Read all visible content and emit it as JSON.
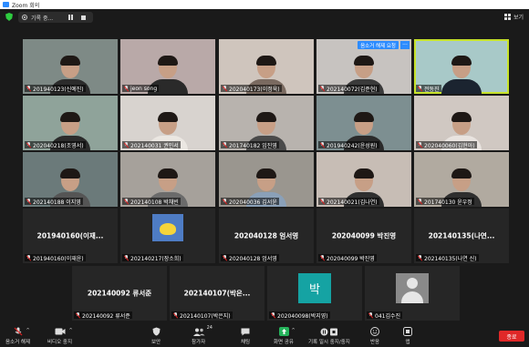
{
  "window": {
    "title": "Zoom 회의"
  },
  "topbar": {
    "recording_label": "기록 중...",
    "view_label": "보기"
  },
  "tiles": [
    {
      "name": "201940123(신예진)",
      "kind": "video",
      "bg": "#7e8a86",
      "shirt": "#2b2b2b"
    },
    {
      "name": "jeon song",
      "kind": "video",
      "bg": "#b9a9a8",
      "shirt": "#2a2a2a"
    },
    {
      "name": "202040173(이정욱)",
      "kind": "video",
      "bg": "#cfc5bd",
      "shirt": "#7a6a60"
    },
    {
      "name": "202140072(김준현)",
      "kind": "video",
      "bg": "#c7c3c0",
      "shirt": "#3a3a3a",
      "badge": "음소거 해제 요청",
      "more": "···"
    },
    {
      "name": "전동진",
      "kind": "video",
      "bg": "#a8c9c8",
      "shirt": "#1b2430",
      "active": true
    },
    {
      "name": "202040218(조영서)",
      "kind": "video",
      "bg": "#8fa39a",
      "shirt": "#2b2b2b"
    },
    {
      "name": "202140031 권민서",
      "kind": "video",
      "bg": "#d8d3cf",
      "shirt": "#ebe7e2"
    },
    {
      "name": "201740182 임진영",
      "kind": "video",
      "bg": "#b8b3ae",
      "shirt": "#4a4a4a"
    },
    {
      "name": "201940242(윤성원)",
      "kind": "video",
      "bg": "#7d8f91",
      "shirt": "#2a2a2a"
    },
    {
      "name": "202040060(김현아)",
      "kind": "video",
      "bg": "#d0c8c2",
      "shirt": "#e9e4e0"
    },
    {
      "name": "202140188 이지영",
      "kind": "video",
      "bg": "#6b7a7a",
      "shirt": "#555"
    },
    {
      "name": "202140108 박채빈",
      "kind": "video",
      "bg": "#a6a19b",
      "shirt": "#6b6b6b"
    },
    {
      "name": "202040036 김서윤",
      "kind": "video",
      "bg": "#9a968f",
      "shirt": "#8aa0b8"
    },
    {
      "name": "202140021(김나연)",
      "kind": "video",
      "bg": "#c7bdb5",
      "shirt": "#2f2f2f"
    },
    {
      "name": "201740130 윤우정",
      "kind": "video",
      "bg": "#b1aaa0",
      "shirt": "#2e2e2e"
    },
    {
      "name": "201940160(이재윤)",
      "kind": "text",
      "big": "201940160(이재..."
    },
    {
      "name": "202140217(장소희)",
      "kind": "avatar-blue"
    },
    {
      "name": "202040128 엄서영",
      "kind": "text",
      "big": "202040128 엄서영"
    },
    {
      "name": "202040099 박진영",
      "kind": "text",
      "big": "202040099 박진영"
    },
    {
      "name": "202140135(나연 신)",
      "kind": "text",
      "big": "202140135(나연..."
    },
    {
      "name": "202140092 류서준",
      "kind": "text",
      "big": "202140092 류서준"
    },
    {
      "name": "202140107(박은지)",
      "kind": "text",
      "big": "202140107(박은..."
    },
    {
      "name": "202040098(박지영)",
      "kind": "avatar-teal",
      "initial": "박"
    },
    {
      "name": "041김수진",
      "kind": "avatar-gray"
    }
  ],
  "toolbar": {
    "unmute": "음소거 해제",
    "stop_video": "비디오 중지",
    "security": "보안",
    "participants": "참가자",
    "participants_count": "24",
    "chat": "채팅",
    "share": "화면 공유",
    "record": "기록 일시 중지/중지",
    "reactions": "반응",
    "apps": "앱",
    "end": "종료"
  },
  "colors": {
    "accent": "#2d8cff",
    "end": "#e02828",
    "active_border": "#c7e22a",
    "share_green": "#25b35b"
  }
}
